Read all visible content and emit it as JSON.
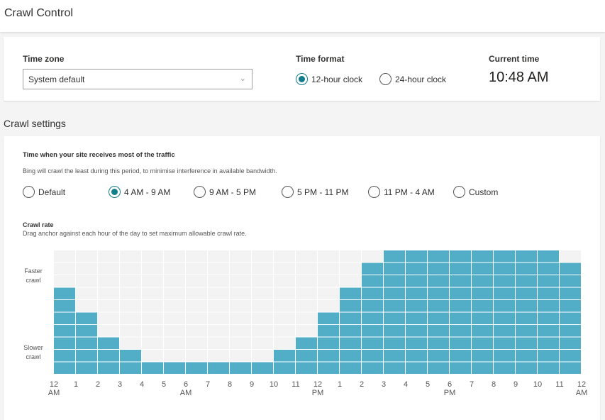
{
  "header": {
    "title": "Crawl Control"
  },
  "timezone": {
    "label": "Time zone",
    "value": "System default"
  },
  "time_format": {
    "label": "Time format",
    "options": [
      {
        "label": "12-hour clock",
        "selected": true
      },
      {
        "label": "24-hour clock",
        "selected": false
      }
    ]
  },
  "current_time": {
    "label": "Current time",
    "value": "10:48 AM"
  },
  "crawl_settings": {
    "title": "Crawl settings",
    "traffic_label": "Time when your site receives most of the traffic",
    "traffic_desc": "Bing will crawl the least during this period, to minimise interference in available bandwidth.",
    "traffic_options": [
      {
        "label": "Default",
        "selected": false
      },
      {
        "label": "4 AM - 9 AM",
        "selected": true
      },
      {
        "label": "9 AM - 5 PM",
        "selected": false
      },
      {
        "label": "5 PM - 11 PM",
        "selected": false
      },
      {
        "label": "11 PM - 4 AM",
        "selected": false
      },
      {
        "label": "Custom",
        "selected": false
      }
    ],
    "rate_label": "Crawl rate",
    "rate_desc": "Drag anchor against each hour of the day to set maximum allowable crawl rate."
  },
  "colors": {
    "accent": "#0f7d8c",
    "bar": "#52aec6",
    "grid_bg": "#f3f3f3"
  },
  "chart_data": {
    "type": "bar",
    "ylabel_top": "Faster crawl",
    "ylabel_bottom": "Slower crawl",
    "levels": 10,
    "x_ticks": [
      "12",
      "1",
      "2",
      "3",
      "4",
      "5",
      "6",
      "7",
      "8",
      "9",
      "10",
      "11",
      "12",
      "1",
      "2",
      "3",
      "4",
      "5",
      "6",
      "7",
      "8",
      "9",
      "10",
      "11",
      "12"
    ],
    "x_tick_sub": {
      "0": "AM",
      "6": "AM",
      "12": "PM",
      "18": "PM",
      "24": "AM"
    },
    "hours": [
      0,
      1,
      2,
      3,
      4,
      5,
      6,
      7,
      8,
      9,
      10,
      11,
      12,
      13,
      14,
      15,
      16,
      17,
      18,
      19,
      20,
      21,
      22,
      23
    ],
    "values": [
      7,
      5,
      3,
      2,
      1,
      1,
      1,
      1,
      1,
      1,
      2,
      3,
      5,
      7,
      9,
      10,
      10,
      10,
      10,
      10,
      10,
      10,
      10,
      9
    ]
  }
}
